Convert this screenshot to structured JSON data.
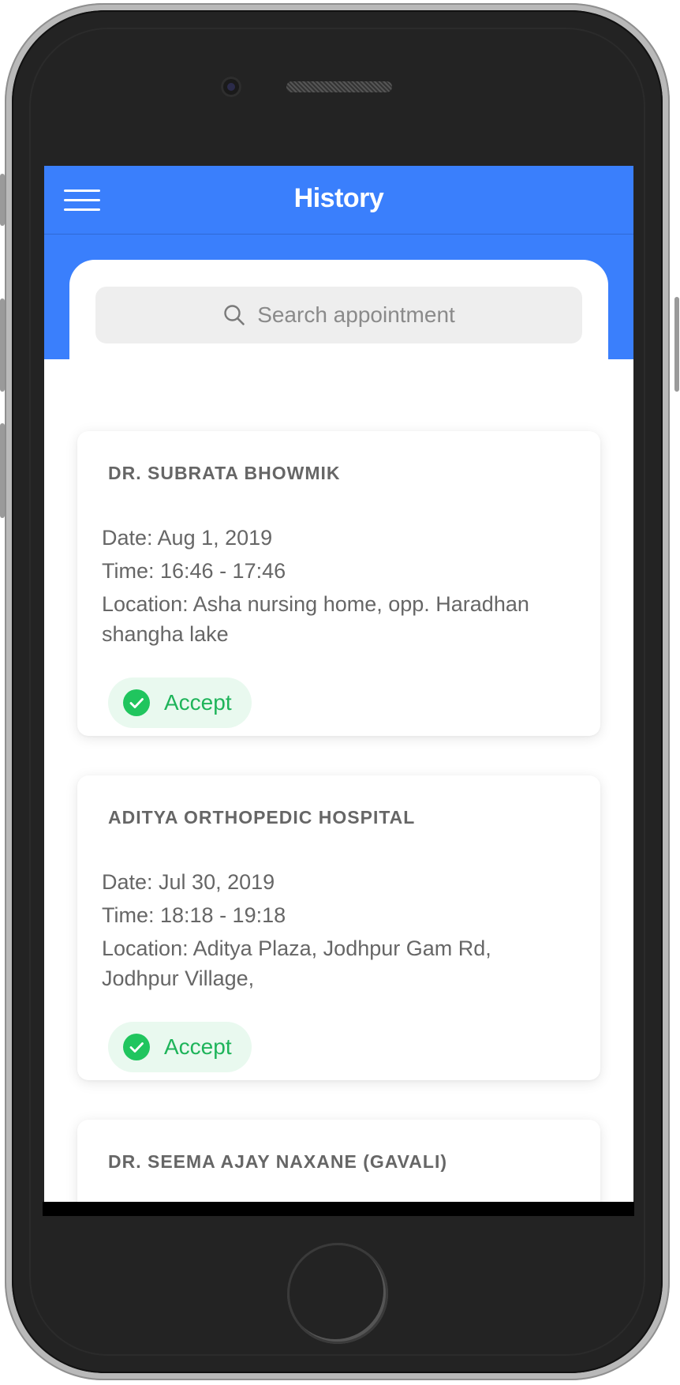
{
  "header": {
    "title": "History",
    "menu_icon": "hamburger-menu-icon",
    "background_color": "#3a7ffc"
  },
  "search": {
    "placeholder": "Search appointment",
    "icon": "search-icon"
  },
  "appointments": [
    {
      "name": "DR. SUBRATA BHOWMIK",
      "date": "Date: Aug 1, 2019",
      "time": "Time: 16:46 - 17:46",
      "location_line1": "Location: Asha nursing home, opp. Haradhan",
      "location_line2": "shangha lake",
      "status": "Accept",
      "status_icon": "check-circle-icon"
    },
    {
      "name": "ADITYA ORTHOPEDIC HOSPITAL",
      "date": "Date: Jul 30, 2019",
      "time": "Time: 18:18 - 19:18",
      "location_line1": "Location: Aditya Plaza, Jodhpur Gam Rd,",
      "location_line2": "Jodhpur Village,",
      "status": "Accept",
      "status_icon": "check-circle-icon"
    },
    {
      "name": "DR. SEEMA AJAY NAXANE (GAVALI)"
    }
  ],
  "colors": {
    "accent": "#3a7ffc",
    "accept_text": "#1eb45a",
    "accept_bg": "#e9f9ef",
    "accept_icon": "#20c55e"
  }
}
